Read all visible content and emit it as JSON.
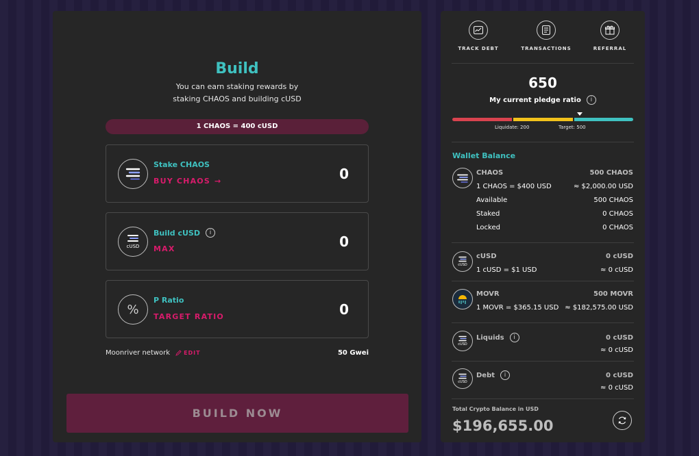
{
  "build": {
    "title": "Build",
    "subtitle_line1": "You can earn staking rewards by",
    "subtitle_line2": "staking CHAOS and building cUSD",
    "rate": "1 CHAOS = 400 cUSD",
    "cards": [
      {
        "title": "Stake CHAOS",
        "link": "BUY CHAOS",
        "value": "0",
        "icon": "chaos-logo-icon"
      },
      {
        "title": "Build cUSD",
        "link": "MAX",
        "value": "0",
        "icon": "cusd-logo-icon",
        "icon_text": "cUSD"
      },
      {
        "title": "P Ratio",
        "link": "TARGET RATIO",
        "value": "0",
        "icon": "percent-icon",
        "icon_text": "%"
      }
    ],
    "network": "Moonriver network",
    "edit": "EDIT",
    "gas": "50 Gwei",
    "button": "BUILD NOW"
  },
  "nav": [
    {
      "label": "TRACK DEBT",
      "icon": "chart-icon"
    },
    {
      "label": "TRANSACTIONS",
      "icon": "document-icon"
    },
    {
      "label": "REFERRAL",
      "icon": "gift-icon"
    }
  ],
  "pledge": {
    "value": "650",
    "label": "My current pledge ratio",
    "liquidate": "Liquidate: 200",
    "target": "Target: 500",
    "colors": {
      "red": "#d9434f",
      "yellow": "#f2c21b",
      "teal": "#3fc1c0"
    }
  },
  "wallet": {
    "title": "Wallet Balance",
    "chaos": {
      "name": "CHAOS",
      "amount": "500 CHAOS",
      "rate": "1 CHAOS = $400 USD",
      "usd": "≈ $2,000.00 USD",
      "available_label": "Available",
      "available": "500 CHAOS",
      "staked_label": "Staked",
      "staked": "0 CHAOS",
      "locked_label": "Locked",
      "locked": "0 CHAOS"
    },
    "cusd": {
      "name": "cUSD",
      "amount": "0 cUSD",
      "rate": "1 cUSD = $1 USD",
      "usd": "≈ 0 cUSD",
      "icon_text": "cUSD"
    },
    "movr": {
      "name": "MOVR",
      "amount": "500 MOVR",
      "rate": "1 MOVR = $365.15 USD",
      "usd": "≈ $182,575.00 USD"
    },
    "liquids": {
      "name": "Liquids",
      "amount": "0 cUSD",
      "usd": "≈ 0 cUSD",
      "icon_text": "cUSD"
    },
    "debt": {
      "name": "Debt",
      "amount": "0 cUSD",
      "usd": "≈ 0 cUSD",
      "icon_text": "cUSD"
    }
  },
  "total": {
    "label": "Total Crypto Balance in USD",
    "value": "$196,655.00"
  },
  "info_glyph": "i",
  "arrow_glyph": "→"
}
